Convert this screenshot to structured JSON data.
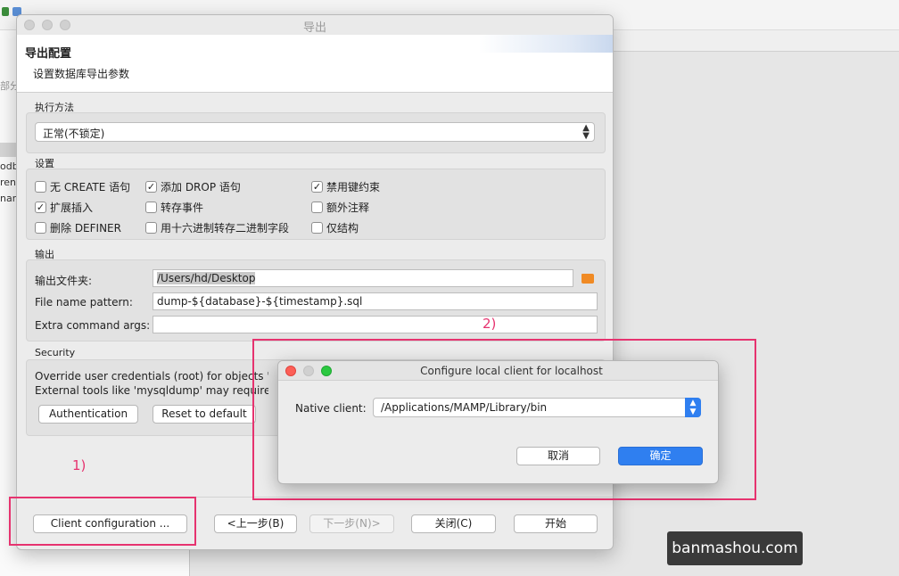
{
  "background": {
    "left_texts": [
      "部分",
      "odb",
      "ren",
      "nan"
    ]
  },
  "dialog": {
    "title": "导出",
    "header_title": "导出配置",
    "header_subtitle": "设置数据库导出参数",
    "method_section": "执行方法",
    "method_value": "正常(不锁定)",
    "settings_section": "设置",
    "settings": [
      {
        "label": "无 CREATE 语句",
        "checked": false
      },
      {
        "label": "添加 DROP 语句",
        "checked": true
      },
      {
        "label": "禁用键约束",
        "checked": true
      },
      {
        "label": "扩展插入",
        "checked": true
      },
      {
        "label": "转存事件",
        "checked": false
      },
      {
        "label": "额外注释",
        "checked": false
      },
      {
        "label": "删除 DEFINER",
        "checked": false
      },
      {
        "label": "用十六进制转存二进制字段",
        "checked": false
      },
      {
        "label": "仅结构",
        "checked": false
      }
    ],
    "output_section": "输出",
    "output_folder_label": "输出文件夹:",
    "output_folder_value": "/Users/hd/Desktop",
    "file_pattern_label": "File name pattern:",
    "file_pattern_value": "dump-${database}-${timestamp}.sql",
    "extra_args_label": "Extra command args:",
    "extra_args_value": "",
    "security_section": "Security",
    "security_line1": "Override user credentials (root) for objects 'bbs'.",
    "security_line2": "External tools like 'mysqldump' may require different",
    "auth_button": "Authentication",
    "reset_button": "Reset to default",
    "client_config_button": "Client configuration ...",
    "back_button": "<上一步(B)",
    "next_button": "下一步(N)>",
    "close_button": "关闭(C)",
    "start_button": "开始"
  },
  "subdialog": {
    "title": "Configure local client for localhost",
    "native_client_label": "Native client:",
    "native_client_value": "/Applications/MAMP/Library/bin",
    "cancel_button": "取消",
    "ok_button": "确定"
  },
  "annotations": {
    "one": "1)",
    "two": "2)"
  },
  "watermark": "banmashou.com",
  "colors": {
    "annotation": "#e6336f",
    "primary": "#2f7ff0",
    "folder_icon": "#f08a24"
  }
}
